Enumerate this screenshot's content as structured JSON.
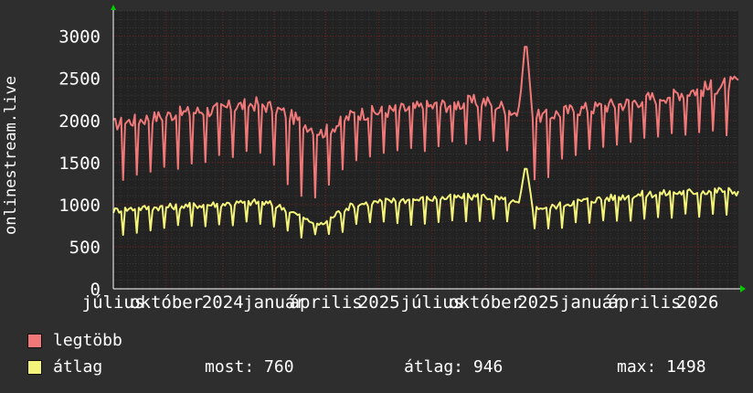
{
  "chart_data": {
    "type": "line",
    "ylabel": "onlinestream.live",
    "ylim": [
      0,
      3300
    ],
    "y_ticks": [
      0,
      500,
      1000,
      1500,
      2000,
      2500,
      3000
    ],
    "x_tick_labels": [
      "július",
      "október",
      "2024",
      "január",
      "április",
      "2025",
      "július",
      "október",
      "2025",
      "január",
      "április",
      "2026"
    ],
    "x_tick_positions": [
      0,
      0.085,
      0.175,
      0.258,
      0.34,
      0.425,
      0.51,
      0.595,
      0.68,
      0.765,
      0.85,
      0.935
    ],
    "grid": true,
    "legend_placement": "bottom",
    "series": [
      {
        "name": "legtöbb",
        "color": "#f07878",
        "baseline": [
          1950,
          1990,
          2020,
          2050,
          2080,
          2100,
          2120,
          2150,
          2180,
          2200,
          2150,
          2060,
          1950,
          1850,
          1950,
          2080,
          2090,
          2110,
          2130,
          2150,
          2170,
          2190,
          2210,
          2230,
          2180,
          2100,
          2050,
          2050,
          2100,
          2130,
          2150,
          2180,
          2200,
          2250,
          2280,
          2320,
          2350,
          2380,
          2420,
          2440
        ],
        "dips": [
          1250,
          1300,
          1350,
          1400,
          1420,
          1460,
          1500,
          1530,
          1550,
          1580,
          1400,
          1150,
          1000,
          1100,
          1300,
          1500,
          1550,
          1580,
          1600,
          1620,
          1650,
          1670,
          1700,
          1720,
          1680,
          1600,
          1300,
          1250,
          1500,
          1600,
          1650,
          1680,
          1700,
          1720,
          1740,
          1780,
          1800,
          1820,
          1850,
          1500
        ],
        "peak": 3010
      },
      {
        "name": "átlag",
        "color": "#f4f47a",
        "baseline": [
          930,
          950,
          960,
          970,
          980,
          990,
          1000,
          1010,
          1020,
          1030,
          1000,
          930,
          820,
          760,
          900,
          1000,
          1020,
          1040,
          1050,
          1060,
          1070,
          1080,
          1090,
          1100,
          1070,
          1020,
          980,
          960,
          1000,
          1040,
          1060,
          1080,
          1100,
          1120,
          1130,
          1140,
          1150,
          1160,
          1170,
          1150
        ],
        "dips": [
          620,
          640,
          660,
          680,
          690,
          700,
          710,
          720,
          730,
          740,
          700,
          640,
          560,
          580,
          640,
          720,
          730,
          740,
          750,
          760,
          770,
          780,
          790,
          800,
          770,
          720,
          660,
          640,
          700,
          740,
          760,
          780,
          790,
          800,
          810,
          820,
          830,
          840,
          850,
          750
        ],
        "peak": 1498
      }
    ]
  },
  "legend": {
    "items": [
      {
        "label": "legtöbb",
        "color": "#f07878"
      },
      {
        "label": "átlag",
        "color": "#f4f47a"
      }
    ],
    "stats": {
      "most": "most: 760",
      "atlag": "átlag: 946",
      "max": "max: 1498"
    }
  },
  "colors": {
    "background": "#2e2e2e",
    "plot_background": "#222222",
    "grid_major": "#7a2020",
    "grid_minor": "#4a4a4a",
    "axis": "#ffffff",
    "arrow": "#00cc00"
  }
}
